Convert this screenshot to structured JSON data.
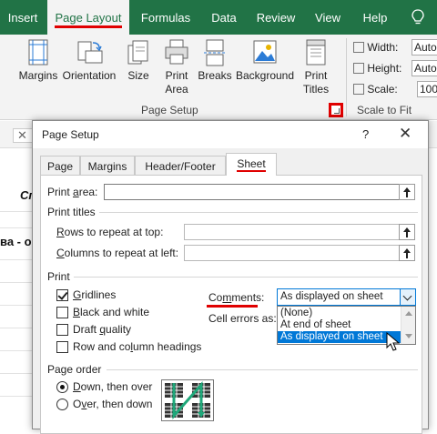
{
  "ribbon_tabs": [
    "Insert",
    "Page Layout",
    "Formulas",
    "Data",
    "Review",
    "View",
    "Help"
  ],
  "ribbon": {
    "page_setup_buttons": [
      {
        "label1": "Margins",
        "label2": "",
        "icon": "margins-icon"
      },
      {
        "label1": "Orientation",
        "label2": "",
        "icon": "orientation-icon"
      },
      {
        "label1": "Size",
        "label2": "",
        "icon": "size-icon"
      },
      {
        "label1": "Print",
        "label2": "Area",
        "icon": "print-area-icon"
      },
      {
        "label1": "Breaks",
        "label2": "",
        "icon": "breaks-icon"
      },
      {
        "label1": "Background",
        "label2": "",
        "icon": "background-icon"
      },
      {
        "label1": "Print",
        "label2": "Titles",
        "icon": "print-titles-icon"
      }
    ],
    "page_setup_group": "Page Setup",
    "scale_group": "Scale to Fit",
    "width_label": "Width:",
    "width_value": "Auto",
    "height_label": "Height:",
    "height_value": "Auto",
    "scale_label": "Scale:",
    "scale_value": "100"
  },
  "background": {
    "row_text_1": "Сп",
    "row_text_2": "ва - об"
  },
  "dialog": {
    "title": "Page Setup",
    "help": "?",
    "close": "✕",
    "tabs": [
      "Page",
      "Margins",
      "Header/Footer",
      "Sheet"
    ],
    "active_tab": "Sheet",
    "print_area_label": "Print area:",
    "print_titles_label": "Print titles",
    "rows_repeat_label": "Rows to repeat at top:",
    "cols_repeat_label": "Columns to repeat at left:",
    "print_section_label": "Print",
    "checkboxes": [
      {
        "label": "Gridlines",
        "checked": true
      },
      {
        "label": "Black and white",
        "checked": false
      },
      {
        "label": "Draft quality",
        "checked": false
      },
      {
        "label": "Row and column headings",
        "checked": false
      }
    ],
    "comments_label": "Comments:",
    "comments_value": "As displayed on sheet",
    "comments_options": [
      "(None)",
      "At end of sheet",
      "As displayed on sheet"
    ],
    "cell_errors_label": "Cell errors as:",
    "page_order_label": "Page order",
    "page_order_options": [
      {
        "label": "Down, then over",
        "selected": true
      },
      {
        "label": "Over, then down",
        "selected": false
      }
    ]
  },
  "colors": {
    "excel_green": "#217346",
    "highlight_red": "#e00000",
    "select_blue": "#0078d7"
  }
}
